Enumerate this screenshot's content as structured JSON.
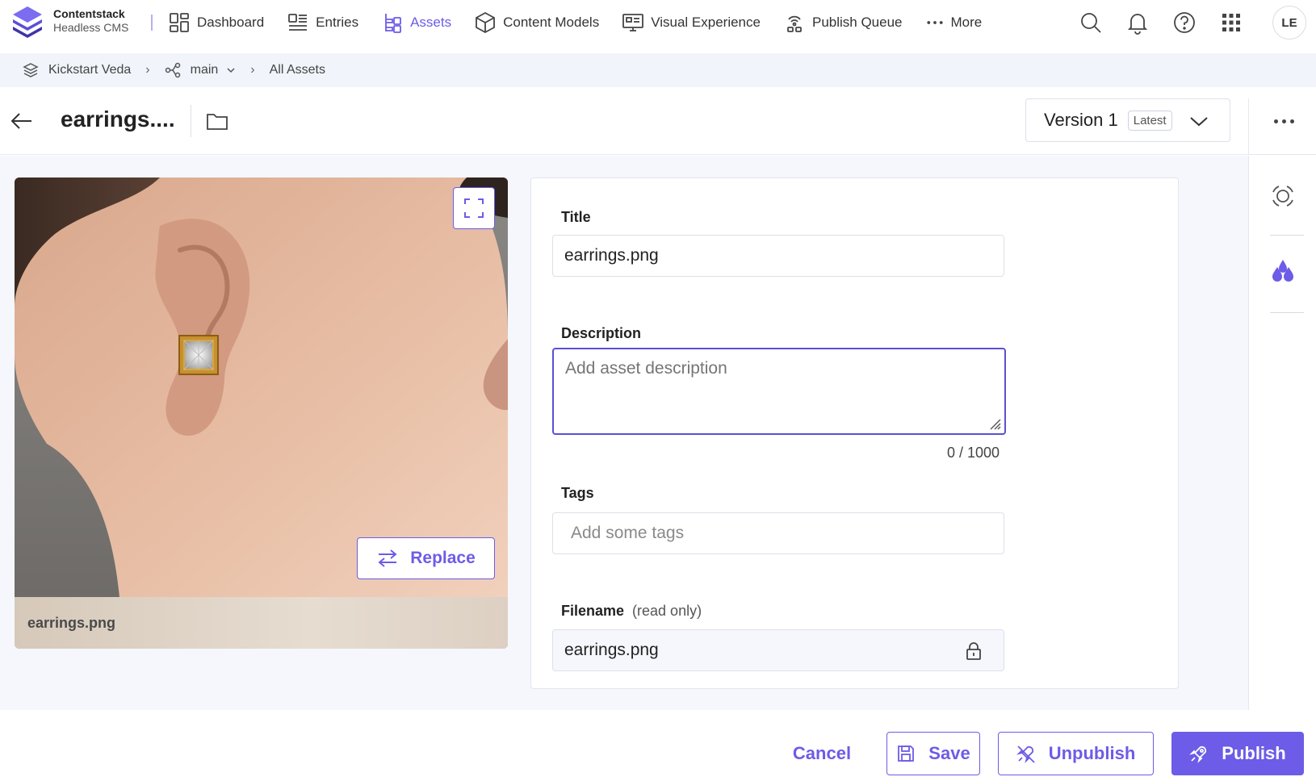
{
  "brand": {
    "name": "Contentstack",
    "subtitle": "Headless CMS"
  },
  "nav": {
    "items": [
      {
        "label": "Dashboard",
        "icon": "dashboard-icon"
      },
      {
        "label": "Entries",
        "icon": "entries-icon"
      },
      {
        "label": "Assets",
        "icon": "assets-icon",
        "active": true
      },
      {
        "label": "Content Models",
        "icon": "cube-icon"
      },
      {
        "label": "Visual Experience",
        "icon": "visual-experience-icon"
      },
      {
        "label": "Publish Queue",
        "icon": "publish-queue-icon"
      },
      {
        "label": "More",
        "icon": "more-dots-icon"
      }
    ],
    "user_initials": "LE"
  },
  "breadcrumb": {
    "stack": "Kickstart Veda",
    "branch": "main",
    "page": "All Assets"
  },
  "header": {
    "title": "earrings....",
    "version_label": "Version 1",
    "version_badge": "Latest"
  },
  "asset": {
    "caption": "earrings.png",
    "replace_label": "Replace"
  },
  "form": {
    "title_label": "Title",
    "title_value": "earrings.png",
    "description_label": "Description",
    "description_placeholder": "Add asset description",
    "char_count": "0 / 1000",
    "tags_label": "Tags",
    "tags_placeholder": "Add some tags",
    "filename_label": "Filename",
    "filename_note": "(read only)",
    "filename_value": "earrings.png"
  },
  "footer": {
    "cancel": "Cancel",
    "save": "Save",
    "unpublish": "Unpublish",
    "publish": "Publish"
  },
  "colors": {
    "accent": "#6c5ce7",
    "breadcrumb_bg": "#f1f4fb",
    "main_bg": "#f5f7fc"
  }
}
